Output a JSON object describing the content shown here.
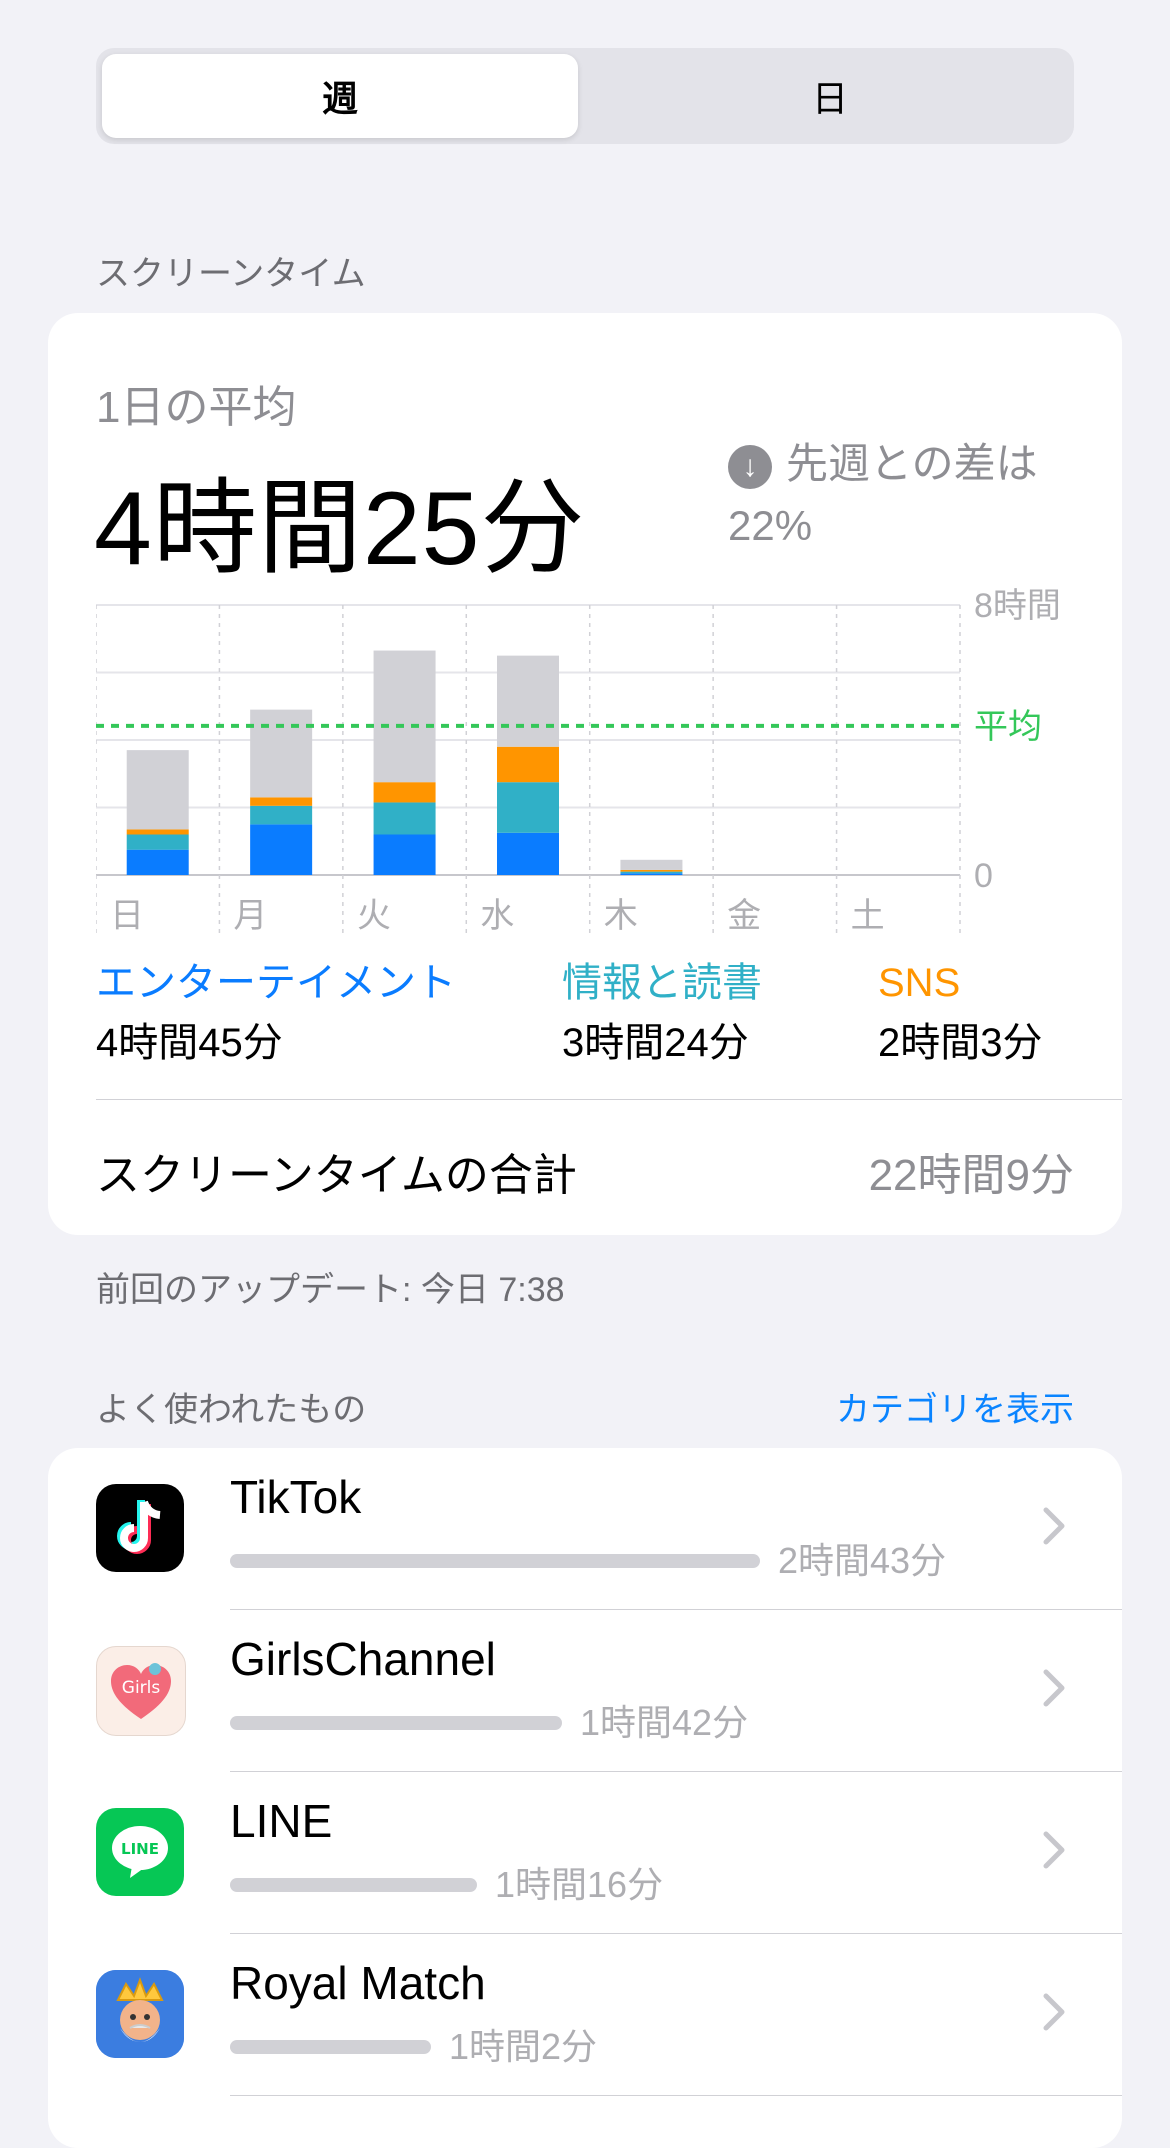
{
  "segment": {
    "week": "週",
    "day": "日"
  },
  "screen_time_header": "スクリーンタイム",
  "summary": {
    "avg_label": "1日の平均",
    "avg_value": "4時間25分",
    "diff_line1": "先週との差は",
    "diff_line2": "22%"
  },
  "chart_data": {
    "type": "bar",
    "stacked": true,
    "categories": [
      "日",
      "月",
      "火",
      "水",
      "木",
      "金",
      "土"
    ],
    "ylabel_max": "8時間",
    "ylabel_min": "0",
    "average_label": "平均",
    "average_value": 4.42,
    "ylim": [
      0,
      8
    ],
    "series": [
      {
        "name": "エンターテイメント",
        "color": "#0a7cff",
        "values": [
          0.75,
          1.5,
          1.2,
          1.25,
          0.05,
          0,
          0
        ]
      },
      {
        "name": "情報と読書",
        "color": "#30b0c7",
        "values": [
          0.45,
          0.55,
          0.95,
          1.5,
          0.05,
          0,
          0
        ]
      },
      {
        "name": "SNS",
        "color": "#ff9500",
        "values": [
          0.15,
          0.25,
          0.6,
          1.05,
          0.05,
          0,
          0
        ]
      },
      {
        "name": "その他",
        "color": "#d1d1d6",
        "values": [
          2.35,
          2.6,
          3.9,
          2.7,
          0.3,
          0,
          0
        ]
      }
    ]
  },
  "legend": [
    {
      "label": "エンターテイメント",
      "time": "4時間45分",
      "color": "#0a7cff"
    },
    {
      "label": "情報と読書",
      "time": "3時間24分",
      "color": "#30b0c7"
    },
    {
      "label": "SNS",
      "time": "2時間3分",
      "color": "#ff9500"
    }
  ],
  "total": {
    "label": "スクリーンタイムの合計",
    "value": "22時間9分"
  },
  "updated": "前回のアップデート: 今日 7:38",
  "most_used": {
    "header": "よく使われたもの",
    "link": "カテゴリを表示"
  },
  "apps": [
    {
      "name": "TikTok",
      "time": "2時間43分",
      "fraction": 1.0,
      "icon": "tiktok-icon"
    },
    {
      "name": "GirlsChannel",
      "time": "1時間42分",
      "fraction": 0.626,
      "icon": "girlschannel-icon"
    },
    {
      "name": "LINE",
      "time": "1時間16分",
      "fraction": 0.466,
      "icon": "line-icon"
    },
    {
      "name": "Royal Match",
      "time": "1時間2分",
      "fraction": 0.38,
      "icon": "royal-match-icon"
    }
  ]
}
